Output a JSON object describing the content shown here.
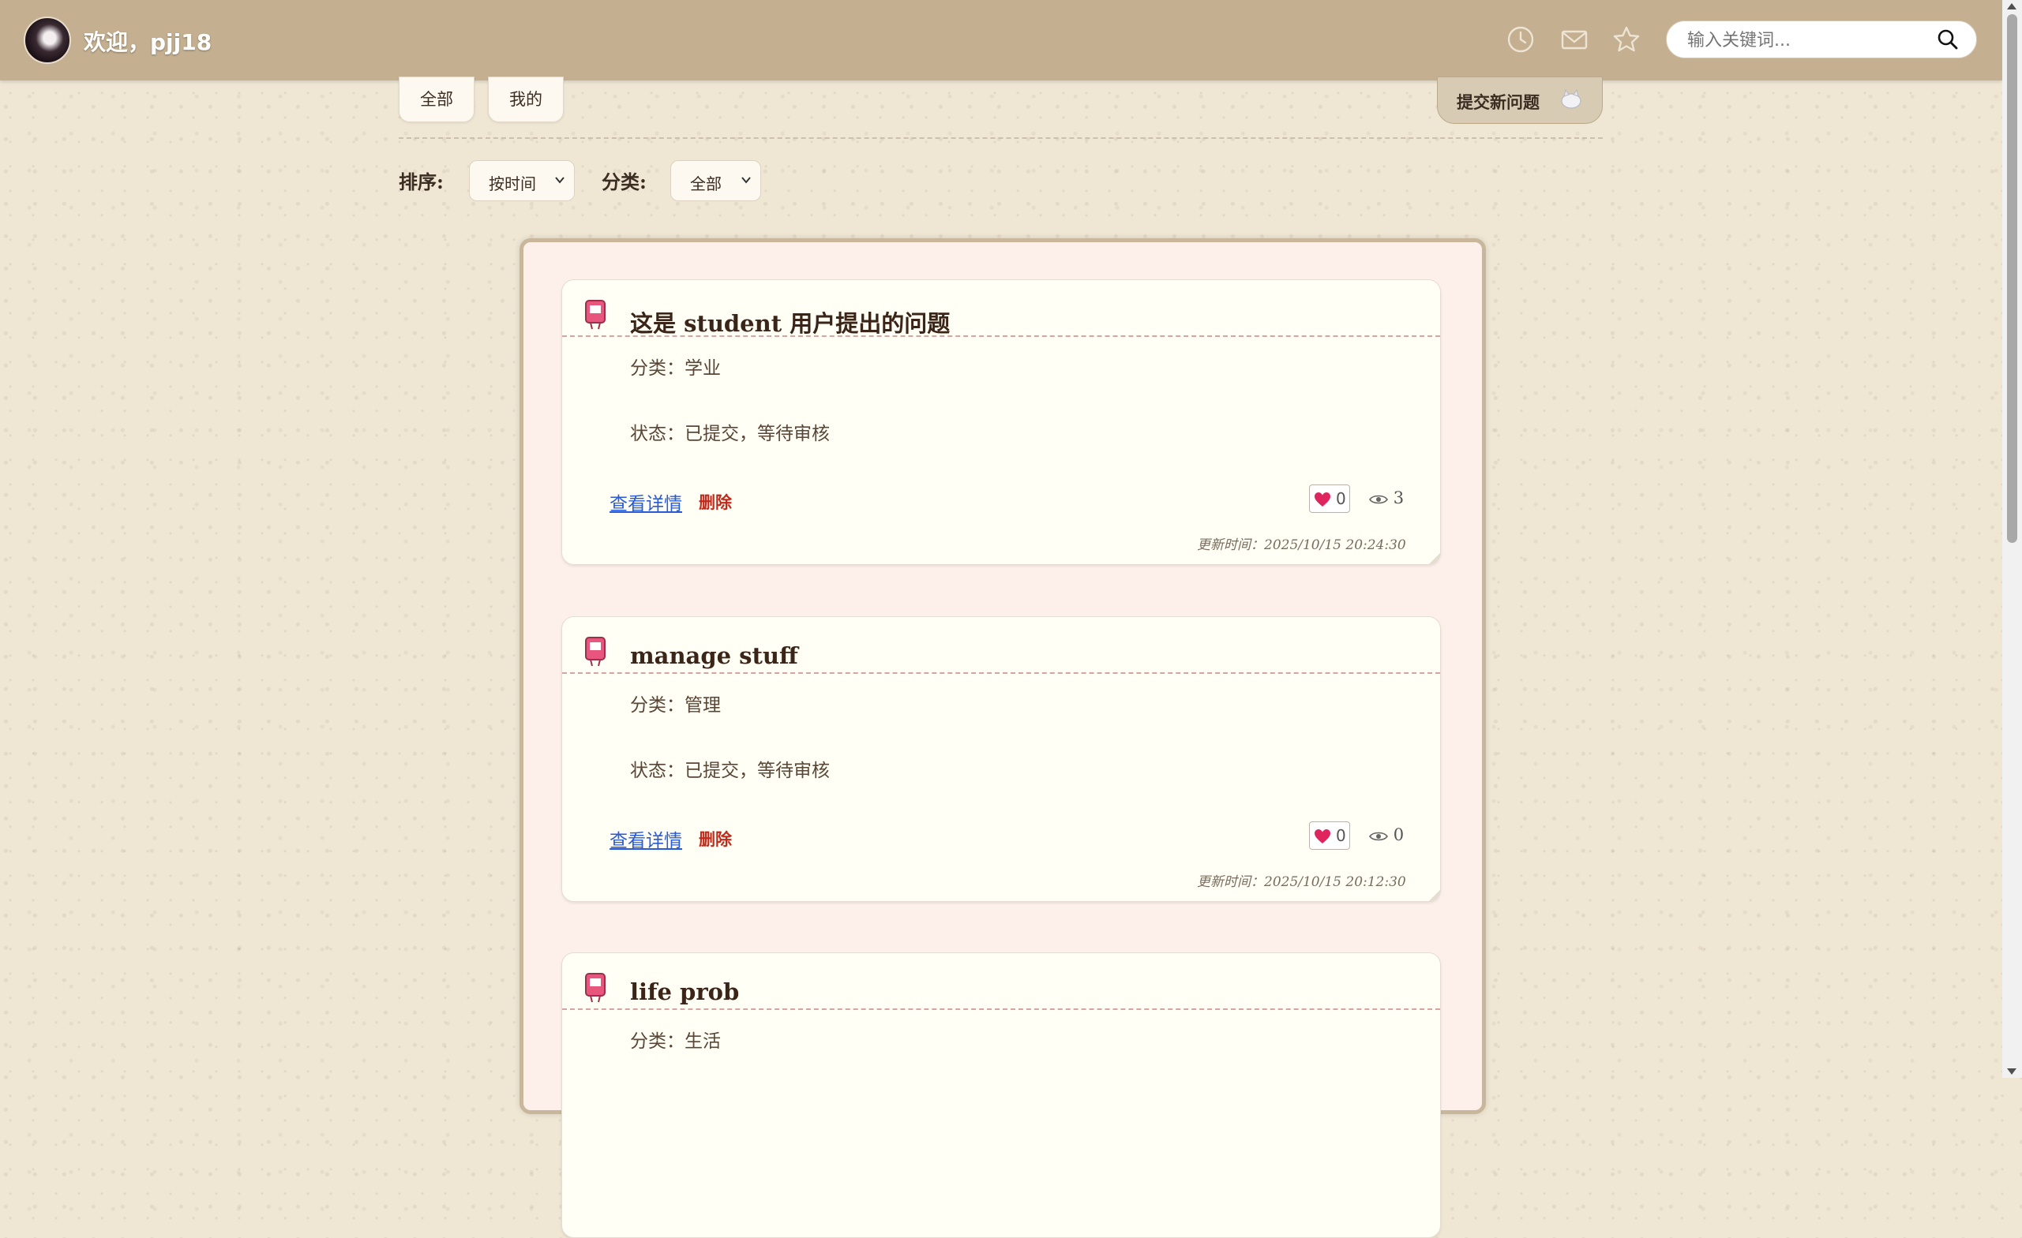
{
  "header": {
    "welcome": "欢迎，pjj18",
    "icons": [
      "history-icon",
      "mail-icon",
      "star-icon"
    ],
    "search_placeholder": "输入关键词..."
  },
  "tabs": [
    {
      "label": "全部"
    },
    {
      "label": "我的"
    }
  ],
  "submit_button": {
    "label": "提交新问题"
  },
  "filters": {
    "sort_label": "排序:",
    "sort_value": "按时间",
    "category_label": "分类:",
    "category_value": "全部"
  },
  "questions": [
    {
      "title": "这是 student 用户提出的问题",
      "category": "分类：学业",
      "status": "状态：已提交，等待审核",
      "detail_label": "查看详情",
      "delete_label": "删除",
      "likes": "0",
      "views": "3",
      "updated": "更新时间：2025/10/15 20:24:30"
    },
    {
      "title": "manage stuff",
      "category": "分类：管理",
      "status": "状态：已提交，等待审核",
      "detail_label": "查看详情",
      "delete_label": "删除",
      "likes": "0",
      "views": "0",
      "updated": "更新时间：2025/10/15 20:12:30"
    },
    {
      "title": "life prob",
      "category": "分类：生活"
    }
  ],
  "colors": {
    "header_bg": "#c4b090",
    "page_bg": "#efe6d4",
    "link": "#2a5bd7",
    "delete": "#c02a1a",
    "heart": "#e0245e"
  }
}
